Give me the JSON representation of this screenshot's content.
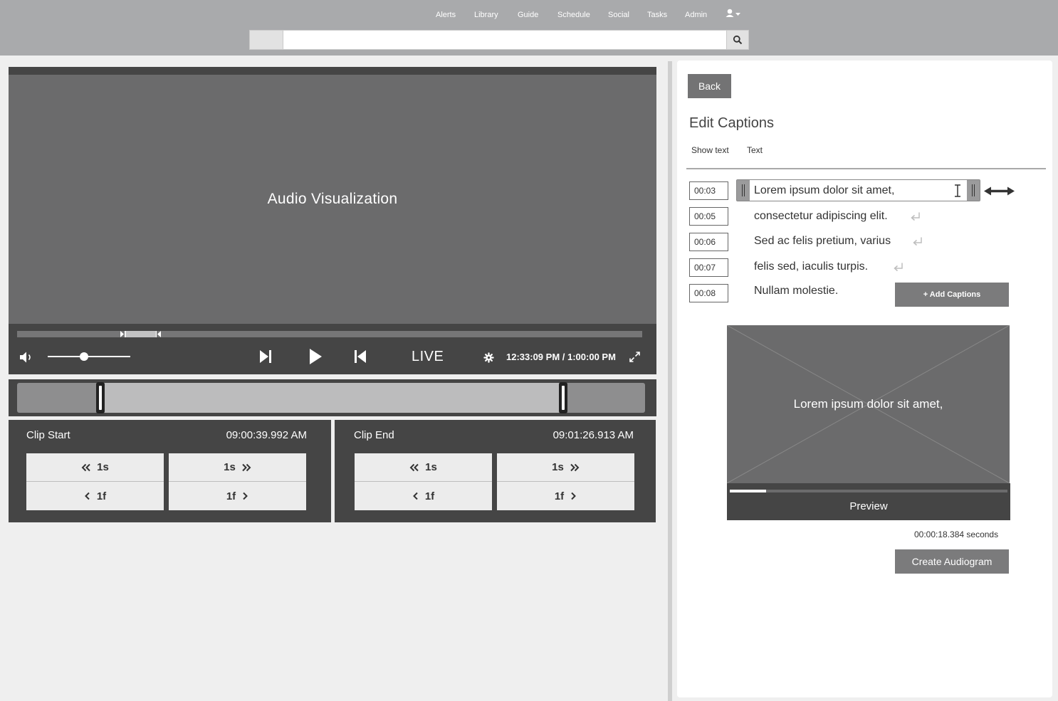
{
  "nav": {
    "items": [
      "Alerts",
      "Library",
      "Guide",
      "Schedule",
      "Social",
      "Tasks",
      "Admin"
    ]
  },
  "search": {
    "value": "",
    "placeholder": ""
  },
  "player": {
    "visualization_label": "Audio Visualization",
    "live_label": "LIVE",
    "time_readout": "12:33:09 PM / 1:00:00 PM",
    "volume_level": 0.44
  },
  "clip_start": {
    "title": "Clip Start",
    "time": "09:00:39.992 AM",
    "back_1s": "1s",
    "fwd_1s": "1s",
    "back_1f": "1f",
    "fwd_1f": "1f"
  },
  "clip_end": {
    "title": "Clip End",
    "time": "09:01:26.913 AM",
    "back_1s": "1s",
    "fwd_1s": "1s",
    "back_1f": "1f",
    "fwd_1f": "1f"
  },
  "captions_panel": {
    "back_label": "Back",
    "title": "Edit Captions",
    "tabs": [
      "Show text",
      "Text"
    ],
    "captions": [
      {
        "time": "00:03",
        "text": "Lorem ipsum dolor sit amet,"
      },
      {
        "time": "00:05",
        "text": "consectetur adipiscing elit."
      },
      {
        "time": "00:06",
        "text": "Sed ac felis pretium, varius"
      },
      {
        "time": "00:07",
        "text": "felis sed, iaculis turpis."
      },
      {
        "time": "00:08",
        "text": "Nullam molestie."
      }
    ],
    "add_captions_label": "+ Add Captions",
    "preview_caption": "Lorem ipsum dolor sit amet,",
    "preview_label": "Preview",
    "preview_progress": 0.13,
    "duration": "00:00:18.384 seconds",
    "create_label": "Create Audiogram"
  },
  "colors": {
    "header_bg": "#a9aaac",
    "dark_panel": "#454545",
    "video_bg": "#6b6b6c",
    "button_gray": "#7b7b7c"
  }
}
